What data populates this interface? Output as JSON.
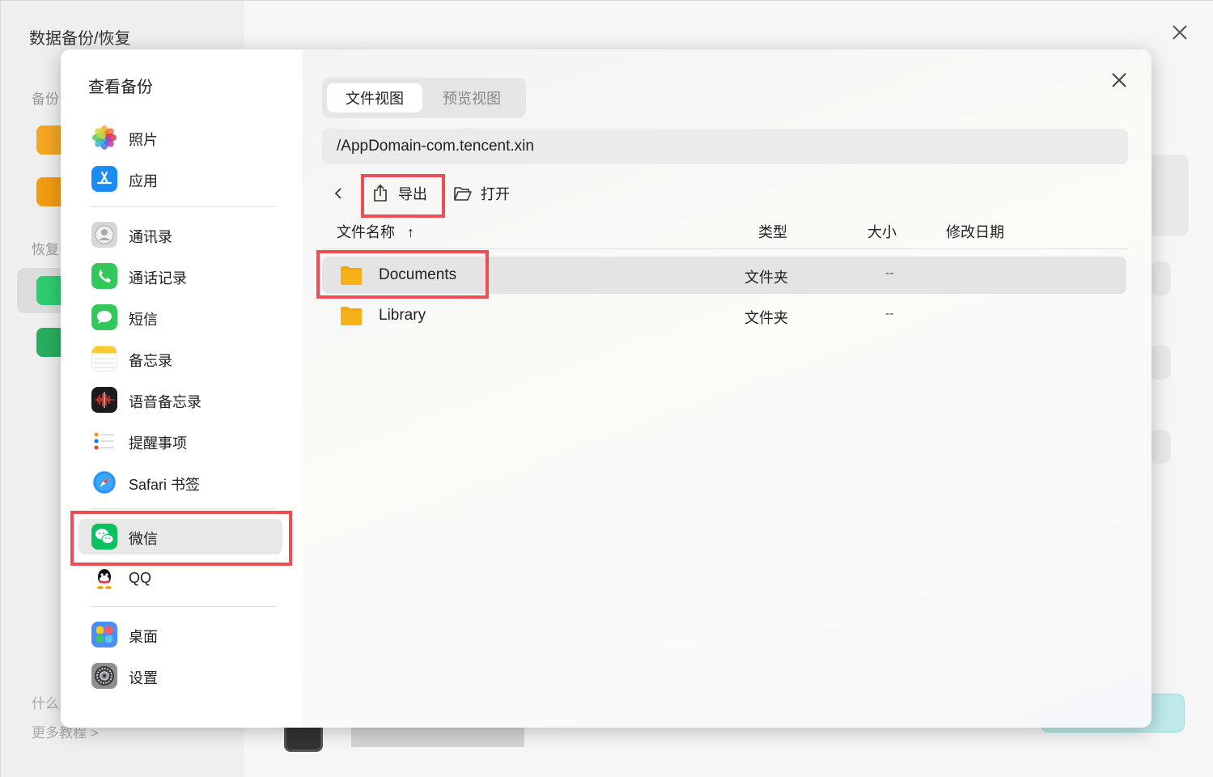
{
  "app": {
    "title": "数据备份/恢复",
    "sections": {
      "backup": "备份",
      "restore": "恢复"
    },
    "bottom": {
      "question": "什么",
      "more": "更多教程 >"
    }
  },
  "modal": {
    "sidebar_title": "查看备份",
    "sidebar_items": [
      {
        "label": "照片",
        "icon": "photos-icon"
      },
      {
        "label": "应用",
        "icon": "app-store-icon"
      },
      {
        "label": "通讯录",
        "icon": "contacts-icon"
      },
      {
        "label": "通话记录",
        "icon": "phone-icon"
      },
      {
        "label": "短信",
        "icon": "messages-icon"
      },
      {
        "label": "备忘录",
        "icon": "notes-icon"
      },
      {
        "label": "语音备忘录",
        "icon": "voice-memos-icon"
      },
      {
        "label": "提醒事项",
        "icon": "reminders-icon"
      },
      {
        "label": "Safari 书签",
        "icon": "safari-icon"
      },
      {
        "label": "微信",
        "icon": "wechat-icon",
        "selected": true
      },
      {
        "label": "QQ",
        "icon": "qq-icon"
      },
      {
        "label": "桌面",
        "icon": "home-screen-icon"
      },
      {
        "label": "设置",
        "icon": "settings-icon"
      }
    ],
    "tabs": [
      {
        "label": "文件视图",
        "active": true
      },
      {
        "label": "预览视图",
        "active": false
      }
    ],
    "path": "/AppDomain-com.tencent.xin",
    "toolbar": {
      "export_label": "导出",
      "open_label": "打开"
    },
    "columns": {
      "name": "文件名称",
      "sort_icon": "↑",
      "type": "类型",
      "size": "大小",
      "modified": "修改日期"
    },
    "files": [
      {
        "name": "Documents",
        "type": "文件夹",
        "size": "--",
        "modified": "",
        "selected": true
      },
      {
        "name": "Library",
        "type": "文件夹",
        "size": "--",
        "modified": "",
        "selected": false
      }
    ],
    "highlight_color": "#ee4d55",
    "folder_color": "#f4a60b"
  }
}
